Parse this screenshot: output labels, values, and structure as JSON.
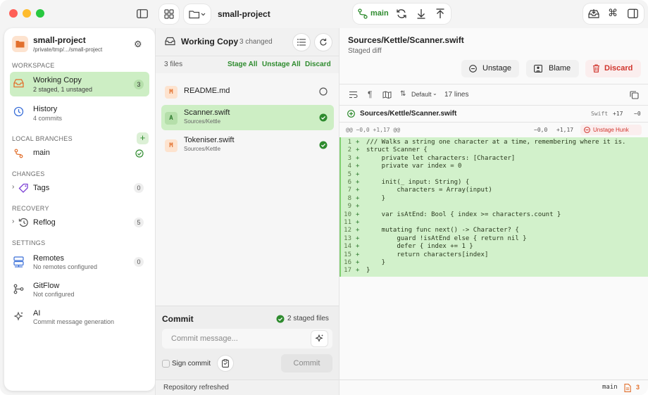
{
  "window": {
    "repo_name": "small-project",
    "branch": "main"
  },
  "sidebar": {
    "repo_title": "small-project",
    "repo_path": "/private/tmp/.../small-project",
    "workspace_header": "WORKSPACE",
    "working_copy": {
      "title": "Working Copy",
      "subtitle": "2 staged, 1 unstaged",
      "count": "3"
    },
    "history": {
      "title": "History",
      "subtitle": "4 commits"
    },
    "local_branches_header": "LOCAL BRANCHES",
    "branch_main": "main",
    "changes_header": "CHANGES",
    "tags": {
      "title": "Tags",
      "count": "0"
    },
    "recovery_header": "RECOVERY",
    "reflog": {
      "title": "Reflog",
      "count": "5"
    },
    "settings_header": "SETTINGS",
    "remotes": {
      "title": "Remotes",
      "subtitle": "No remotes configured",
      "count": "0"
    },
    "gitflow": {
      "title": "GitFlow",
      "subtitle": "Not configured"
    },
    "ai": {
      "title": "AI",
      "subtitle": "Commit message generation"
    }
  },
  "middle": {
    "title": "Working Copy",
    "changed": "3 changed",
    "file_count": "3 files",
    "stage_all": "Stage All",
    "unstage_all": "Unstage All",
    "discard": "Discard",
    "files": [
      {
        "letter": "M",
        "name": "README.md",
        "path": ""
      },
      {
        "letter": "A",
        "name": "Scanner.swift",
        "path": "Sources/Kettle"
      },
      {
        "letter": "M",
        "name": "Tokeniser.swift",
        "path": "Sources/Kettle"
      }
    ],
    "commit_title": "Commit",
    "staged_files": "2 staged files",
    "commit_placeholder": "Commit message...",
    "sign_commit": "Sign commit",
    "commit_button": "Commit",
    "status": "Repository refreshed"
  },
  "diff": {
    "file_path": "Sources/Kettle/Scanner.swift",
    "subtitle": "Staged diff",
    "unstage": "Unstage",
    "blame": "Blame",
    "discard": "Discard",
    "mode": "Default",
    "line_count": "17 lines",
    "file_header": "Sources/Kettle/Scanner.swift",
    "language": "Swift",
    "additions": "+17",
    "deletions": "−0",
    "hunk_header": "@@ −0,0 +1,17 @@",
    "hunk_left": "−0,0",
    "hunk_right": "+1,17",
    "unstage_hunk": "Unstage Hunk",
    "lines": [
      {
        "n": "1",
        "text": "/// Walks a string one character at a time, remembering where it is."
      },
      {
        "n": "2",
        "text": "struct Scanner {"
      },
      {
        "n": "3",
        "text": "    private let characters: [Character]"
      },
      {
        "n": "4",
        "text": "    private var index = 0"
      },
      {
        "n": "5",
        "text": ""
      },
      {
        "n": "6",
        "text": "    init(_ input: String) {"
      },
      {
        "n": "7",
        "text": "        characters = Array(input)"
      },
      {
        "n": "8",
        "text": "    }"
      },
      {
        "n": "9",
        "text": ""
      },
      {
        "n": "10",
        "text": "    var isAtEnd: Bool { index >= characters.count }"
      },
      {
        "n": "11",
        "text": ""
      },
      {
        "n": "12",
        "text": "    mutating func next() -> Character? {"
      },
      {
        "n": "13",
        "text": "        guard !isAtEnd else { return nil }"
      },
      {
        "n": "14",
        "text": "        defer { index += 1 }"
      },
      {
        "n": "15",
        "text": "        return characters[index]"
      },
      {
        "n": "16",
        "text": "    }"
      },
      {
        "n": "17",
        "text": "}"
      }
    ],
    "status_branch": "main",
    "status_count": "3"
  },
  "colors": {
    "accent_green": "#2e8b2e",
    "staged_bg": "#cdeec4",
    "diff_added_bg": "#d2f1cb",
    "discard_red": "#d0342c"
  }
}
